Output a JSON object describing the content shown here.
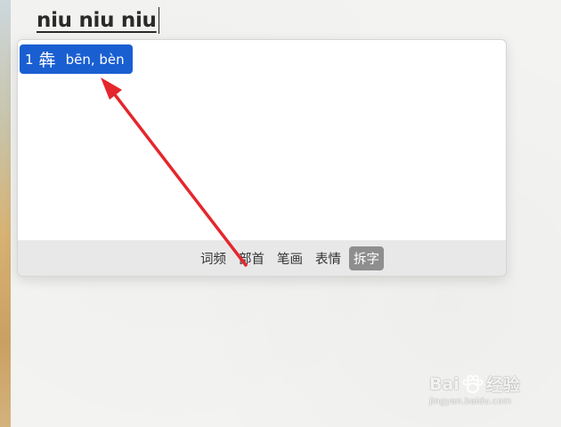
{
  "composition": {
    "text": "niu niu niu"
  },
  "candidate": {
    "index": "1",
    "character": "犇",
    "pinyin": "bēn, bèn"
  },
  "tabs": [
    {
      "label": "词频",
      "active": false
    },
    {
      "label": "部首",
      "active": false
    },
    {
      "label": "笔画",
      "active": false
    },
    {
      "label": "表情",
      "active": false
    },
    {
      "label": "拆字",
      "active": true
    }
  ],
  "colors": {
    "selection": "#1a5fd1",
    "arrow": "#e5262d",
    "active_tab": "#8e8e8e"
  },
  "watermark": {
    "brand_left": "Bai",
    "brand_right": "经验",
    "url": "jingyan.baidu.com"
  },
  "icons": {
    "watermark": "paw-icon"
  }
}
